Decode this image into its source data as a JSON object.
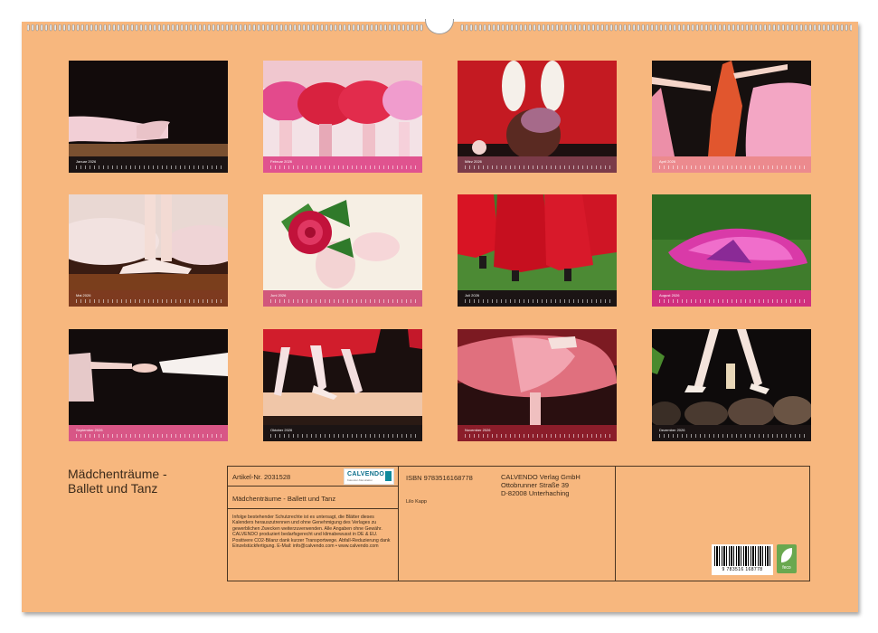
{
  "calendar": {
    "title_line1": "Mädchenträume -",
    "title_line2": "Ballett und Tanz",
    "months": [
      {
        "label": "Januar 2026",
        "strip_color": "#1b1414"
      },
      {
        "label": "Februar 2026",
        "strip_color": "#e0538f"
      },
      {
        "label": "März 2026",
        "strip_color": "#7b3b49"
      },
      {
        "label": "April 2026",
        "strip_color": "#ec8a8e"
      },
      {
        "label": "Mai 2026",
        "strip_color": "#7d3a1f"
      },
      {
        "label": "Juni 2026",
        "strip_color": "#d1577c"
      },
      {
        "label": "Juli 2026",
        "strip_color": "#1b1414"
      },
      {
        "label": "August 2026",
        "strip_color": "#d0307e"
      },
      {
        "label": "September 2026",
        "strip_color": "#d85686"
      },
      {
        "label": "Oktober 2026",
        "strip_color": "#1b1414"
      },
      {
        "label": "November 2026",
        "strip_color": "#8b1d2a"
      },
      {
        "label": "Dezember 2026",
        "strip_color": "#1b1414"
      }
    ]
  },
  "info": {
    "article_no": "Artikel-Nr. 2031528",
    "product_title": "Mädchenträume - Ballett und Tanz",
    "legal_text": "Infolge bestehender Schutzrechte ist es untersagt, die Blätter dieses Kalenders herauszutrennen und ohne Genehmigung des Verlages zu gewerblichen Zwecken weiterzuverwenden. Alle Angaben ohne Gewähr. CALVENDO produziert bedarfsgerecht und klimabewusst in DE & EU. Positivere CO2-Bilanz dank kurzer Transportwege. Abfall-Reduzierung dank Einzelstückfertigung. E-Mail: info@calvendo.com • www.calvendo.com",
    "logo_text": "CALVENDO",
    "logo_subtext": "Kalender-Manufaktur",
    "isbn": "ISBN 9783516168778",
    "author": "Lilo Kapp",
    "publisher_line1": "CALVENDO Verlag GmbH",
    "publisher_line2": "Ottobrunner Straße 39",
    "publisher_line3": "D-82008 Unterhaching",
    "barcode_number": "9 783516 168778",
    "feco_label": "feco"
  },
  "colors": {
    "page_background": "#f7b77e",
    "border": "#4a3522"
  }
}
